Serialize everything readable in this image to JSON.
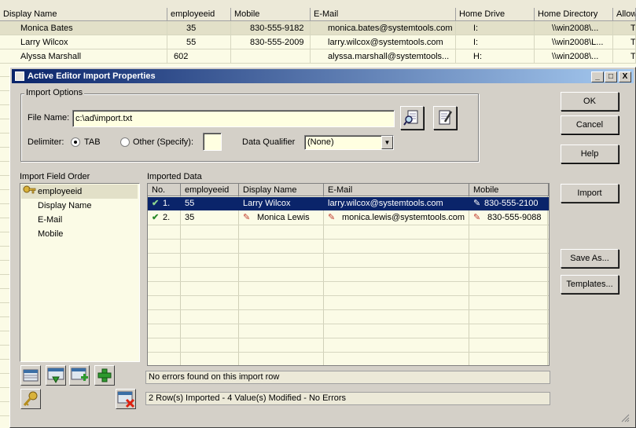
{
  "background": {
    "columns": [
      "Display Name",
      "employeeid",
      "Mobile",
      "E-Mail",
      "Home Drive",
      "Home Directory",
      "Allow"
    ],
    "rows": [
      [
        "Monica Bates",
        "35",
        "830-555-9182",
        "monica.bates@systemtools.com",
        "I:",
        "\\\\win2008\\...",
        "T"
      ],
      [
        "Larry Wilcox",
        "55",
        "830-555-2009",
        "larry.wilcox@systemtools.com",
        "I:",
        "\\\\win2008\\L...",
        "T"
      ],
      [
        "Alyssa Marshall",
        "602",
        "",
        "alyssa.marshall@systemtools...",
        "H:",
        "\\\\win2008\\...",
        "T"
      ]
    ]
  },
  "dialog": {
    "title": "Active Editor Import Properties",
    "controls": {
      "minimize": "_",
      "maximize": "□",
      "close": "X"
    },
    "import_options": {
      "group_title": "Import Options",
      "file_name_label": "File Name:",
      "file_name_value": "c:\\ad\\import.txt",
      "delimiter_label": "Delimiter:",
      "tab_label": "TAB",
      "other_label": "Other (Specify):",
      "other_value": "",
      "qualifier_label": "Data Qualifier",
      "qualifier_value": "(None)"
    },
    "buttons": {
      "ok": "OK",
      "cancel": "Cancel",
      "help": "Help",
      "import": "Import",
      "save_as": "Save As...",
      "templates": "Templates..."
    },
    "field_order": {
      "title": "Import Field Order",
      "items": [
        "employeeid",
        "Display Name",
        "E-Mail",
        "Mobile"
      ]
    },
    "imported_data": {
      "title": "Imported Data",
      "columns": [
        "No.",
        "employeeid",
        "Display Name",
        "E-Mail",
        "Mobile"
      ],
      "rows": [
        {
          "no": "1.",
          "employeeid": "55",
          "display_name": "Larry Wilcox",
          "email": "larry.wilcox@systemtools.com",
          "mobile": "830-555-2100",
          "selected": true
        },
        {
          "no": "2.",
          "employeeid": "35",
          "display_name": "Monica Lewis",
          "email": "monica.lewis@systemtools.com",
          "mobile": "830-555-9088",
          "selected": false
        }
      ]
    },
    "status_row": "No errors found on this import row",
    "status_summary": "2 Row(s) Imported - 4 Value(s) Modified - No Errors",
    "colors": {
      "selection": "#0a246a",
      "titlebar": "#0a246a",
      "grid_bg": "#fbfbe6",
      "check": "#2a8a2a",
      "edit_pencil": "#c0392b"
    }
  }
}
